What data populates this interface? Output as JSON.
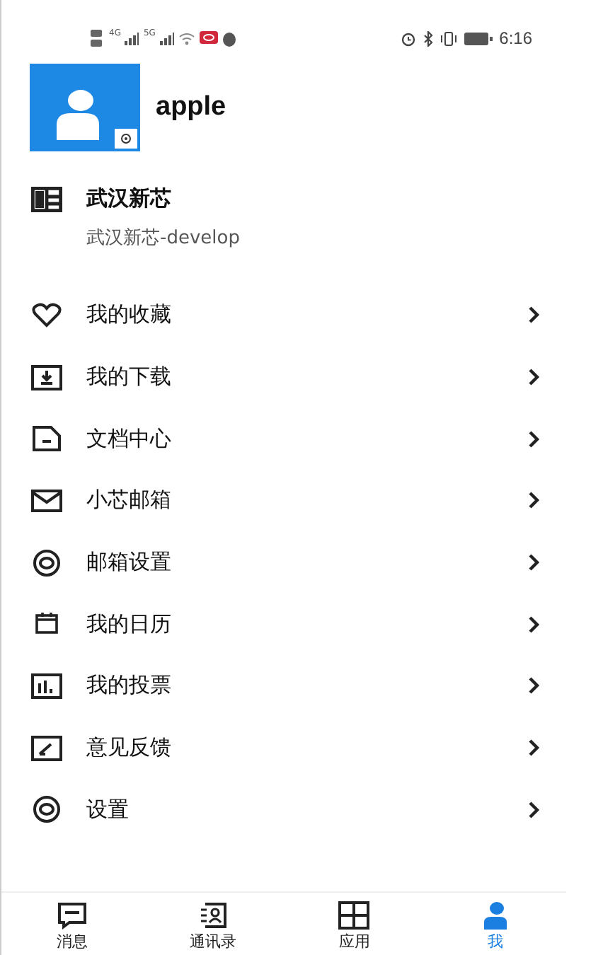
{
  "status_bar": {
    "network_labels": [
      "4G",
      "5G"
    ],
    "time": "6:16"
  },
  "profile": {
    "name": "apple"
  },
  "organization": {
    "name": "武汉新芯",
    "subtitle": "武汉新芯-develop"
  },
  "menu": [
    {
      "kind": "heart",
      "label": "我的收藏"
    },
    {
      "kind": "download",
      "label": "我的下载"
    },
    {
      "kind": "document",
      "label": "文档中心"
    },
    {
      "kind": "mail",
      "label": "小芯邮箱"
    },
    {
      "kind": "ring",
      "label": "邮箱设置"
    },
    {
      "kind": "calendar",
      "label": "我的日历"
    },
    {
      "kind": "chart",
      "label": "我的投票"
    },
    {
      "kind": "feedback",
      "label": "意见反馈"
    },
    {
      "kind": "ring",
      "label": "设置"
    }
  ],
  "bottom_nav": [
    {
      "kind": "message",
      "label": "消息",
      "selected": false
    },
    {
      "kind": "contacts",
      "label": "通讯录",
      "selected": false
    },
    {
      "kind": "apps",
      "label": "应用",
      "selected": false
    },
    {
      "kind": "me",
      "label": "我",
      "selected": true
    }
  ]
}
